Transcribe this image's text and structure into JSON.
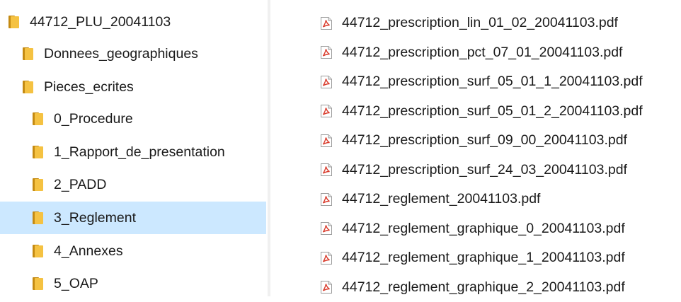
{
  "tree": {
    "items": [
      {
        "label": "44712_PLU_20041103",
        "icon": "folder-icon",
        "level": 0,
        "selected": false
      },
      {
        "label": "Donnees_geographiques",
        "icon": "folder-icon",
        "level": 1,
        "selected": false
      },
      {
        "label": "Pieces_ecrites",
        "icon": "folder-icon",
        "level": 1,
        "selected": false
      },
      {
        "label": "0_Procedure",
        "icon": "folder-icon",
        "level": 2,
        "selected": false
      },
      {
        "label": "1_Rapport_de_presentation",
        "icon": "folder-icon",
        "level": 2,
        "selected": false
      },
      {
        "label": "2_PADD",
        "icon": "folder-icon",
        "level": 2,
        "selected": false
      },
      {
        "label": "3_Reglement",
        "icon": "folder-icon",
        "level": 2,
        "selected": true
      },
      {
        "label": "4_Annexes",
        "icon": "folder-icon",
        "level": 2,
        "selected": false
      },
      {
        "label": "5_OAP",
        "icon": "folder-icon",
        "level": 2,
        "selected": false
      }
    ]
  },
  "files": {
    "items": [
      {
        "name": "44712_prescription_lin_01_02_20041103.pdf",
        "icon": "pdf-icon"
      },
      {
        "name": "44712_prescription_pct_07_01_20041103.pdf",
        "icon": "pdf-icon"
      },
      {
        "name": "44712_prescription_surf_05_01_1_20041103.pdf",
        "icon": "pdf-icon"
      },
      {
        "name": "44712_prescription_surf_05_01_2_20041103.pdf",
        "icon": "pdf-icon"
      },
      {
        "name": "44712_prescription_surf_09_00_20041103.pdf",
        "icon": "pdf-icon"
      },
      {
        "name": "44712_prescription_surf_24_03_20041103.pdf",
        "icon": "pdf-icon"
      },
      {
        "name": "44712_reglement_20041103.pdf",
        "icon": "pdf-icon"
      },
      {
        "name": "44712_reglement_graphique_0_20041103.pdf",
        "icon": "pdf-icon"
      },
      {
        "name": "44712_reglement_graphique_1_20041103.pdf",
        "icon": "pdf-icon"
      },
      {
        "name": "44712_reglement_graphique_2_20041103.pdf",
        "icon": "pdf-icon"
      }
    ]
  },
  "colors": {
    "selection": "#cce8ff",
    "folder": "#f5c242",
    "pdf": "#d93a2b"
  }
}
